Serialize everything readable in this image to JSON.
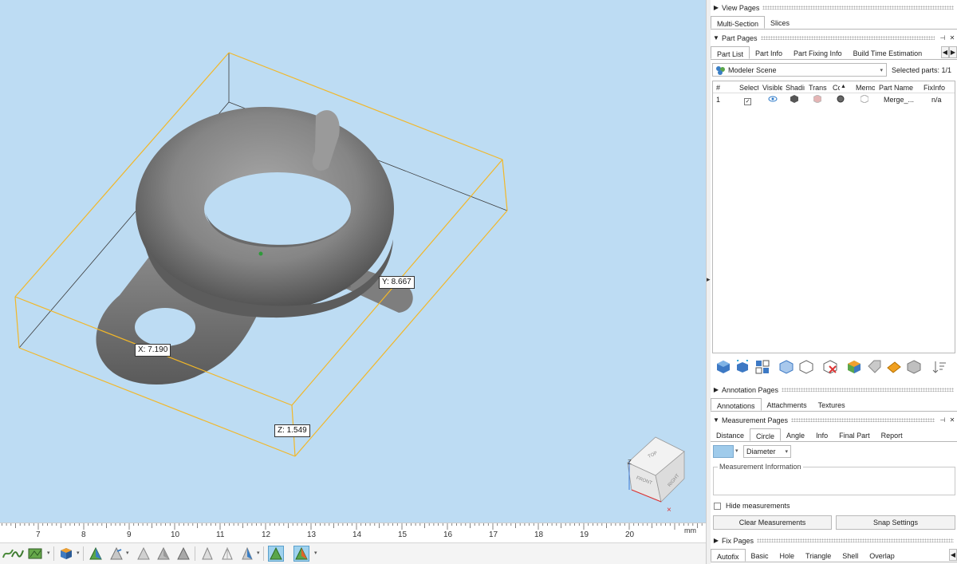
{
  "viewport": {
    "dims": {
      "x": "X: 7.190",
      "y": "Y: 8.667",
      "z": "Z: 1.549"
    },
    "cube_faces": {
      "top": "TOP",
      "front": "FRONT",
      "right": "RIGHT"
    },
    "axis_label": "Z"
  },
  "ruler": {
    "ticks": [
      "7",
      "8",
      "9",
      "10",
      "11",
      "12",
      "13",
      "14",
      "15",
      "16",
      "17",
      "18",
      "19",
      "20"
    ],
    "unit": "mm"
  },
  "bottom_toolbar": {
    "icons": [
      "curve-tool-icon",
      "wave-tool-icon",
      "map-tool-icon",
      "cube-color-icon",
      "pyramid-icon",
      "pyramid-outline-icon",
      "pyramid-grey-icon",
      "pyramid-shaded-icon",
      "pyramid-dark-icon",
      "cone-icon",
      "cone-outline-icon",
      "cone-color-icon",
      "pyramid-active-icon",
      "pyramid-color-active-icon"
    ]
  },
  "view_pages": {
    "title": "View Pages",
    "tabs": [
      "Multi-Section",
      "Slices"
    ]
  },
  "part_pages": {
    "title": "Part Pages",
    "tabs": [
      "Part List",
      "Part Info",
      "Part Fixing Info",
      "Build Time Estimation"
    ],
    "scene": "Modeler Scene",
    "selected_parts": "Selected parts: 1/1",
    "columns": [
      "#",
      "Select",
      "Visible",
      "Shading",
      "Trans",
      "Co",
      "Memo",
      "Part Name",
      "FixInfo"
    ],
    "row": {
      "num": "1",
      "part_name": "Merge_...",
      "fixinfo": "n/a"
    }
  },
  "annotation_pages": {
    "title": "Annotation Pages",
    "tabs": [
      "Annotations",
      "Attachments",
      "Textures"
    ]
  },
  "measurement_pages": {
    "title": "Measurement Pages",
    "tabs": [
      "Distance",
      "Circle",
      "Angle",
      "Info",
      "Final Part",
      "Report"
    ],
    "diameter": "Diameter",
    "info_legend": "Measurement Information",
    "hide_label": "Hide measurements",
    "clear_label": "Clear Measurements",
    "snap_label": "Snap Settings"
  },
  "fix_pages": {
    "title": "Fix Pages",
    "tabs": [
      "Autofix",
      "Basic",
      "Hole",
      "Triangle",
      "Shell",
      "Overlap"
    ]
  },
  "colors": {
    "viewport_bg": "#bddcf3",
    "bounding_box": "#f2b728",
    "part_grey": "#7a7a7a",
    "active_blue": "#9fd2ee"
  }
}
